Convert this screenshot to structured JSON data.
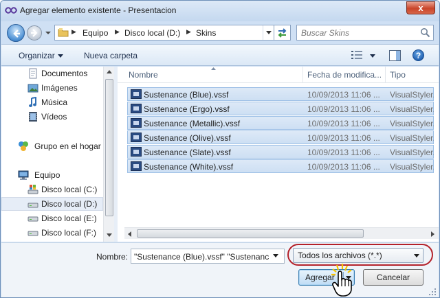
{
  "window": {
    "title": "Agregar elemento existente - Presentacion",
    "close_label": "x"
  },
  "address": {
    "crumbs": [
      "Equipo",
      "Disco local (D:)",
      "Skins"
    ],
    "search_placeholder": "Buscar Skins"
  },
  "toolbar": {
    "organize_label": "Organizar",
    "new_folder_label": "Nueva carpeta",
    "help_label": "?"
  },
  "sidebar": {
    "items": [
      {
        "label": "Documentos",
        "icon": "documents-icon"
      },
      {
        "label": "Imágenes",
        "icon": "pictures-icon"
      },
      {
        "label": "Música",
        "icon": "music-icon"
      },
      {
        "label": "Vídeos",
        "icon": "videos-icon"
      },
      {
        "label": "Grupo en el hogar",
        "icon": "homegroup-icon"
      },
      {
        "label": "Equipo",
        "icon": "computer-icon"
      },
      {
        "label": "Disco local (C:)",
        "icon": "system-drive-icon"
      },
      {
        "label": "Disco local (D:)",
        "icon": "drive-icon",
        "selected": true
      },
      {
        "label": "Disco local (E:)",
        "icon": "drive-icon"
      },
      {
        "label": "Disco local (F:)",
        "icon": "drive-icon"
      }
    ]
  },
  "filelist": {
    "columns": {
      "name": "Nombre",
      "date": "Fecha de modifica...",
      "type": "Tipo"
    },
    "rows": [
      {
        "name": "Sustenance (Blue).vssf",
        "date": "10/09/2013 11:06 ...",
        "type": "VisualStyler.M"
      },
      {
        "name": "Sustenance (Ergo).vssf",
        "date": "10/09/2013 11:06 ...",
        "type": "VisualStyler.M"
      },
      {
        "name": "Sustenance (Metallic).vssf",
        "date": "10/09/2013 11:06 ...",
        "type": "VisualStyler.M"
      },
      {
        "name": "Sustenance (Olive).vssf",
        "date": "10/09/2013 11:06 ...",
        "type": "VisualStyler.M"
      },
      {
        "name": "Sustenance (Slate).vssf",
        "date": "10/09/2013 11:06 ...",
        "type": "VisualStyler.M"
      },
      {
        "name": "Sustenance (White).vssf",
        "date": "10/09/2013 11:06 ...",
        "type": "VisualStyler.M"
      }
    ]
  },
  "footer": {
    "name_label": "Nombre:",
    "name_value": "\"Sustenance (Blue).vssf\" \"Sustenance (",
    "filter_value": "Todos los archivos (*.*)",
    "add_label": "Agregar",
    "cancel_label": "Cancelar"
  },
  "colors": {
    "highlight_ring": "#b4212a",
    "selection_fill": "#cddff3",
    "accent": "#3c7fb1"
  }
}
